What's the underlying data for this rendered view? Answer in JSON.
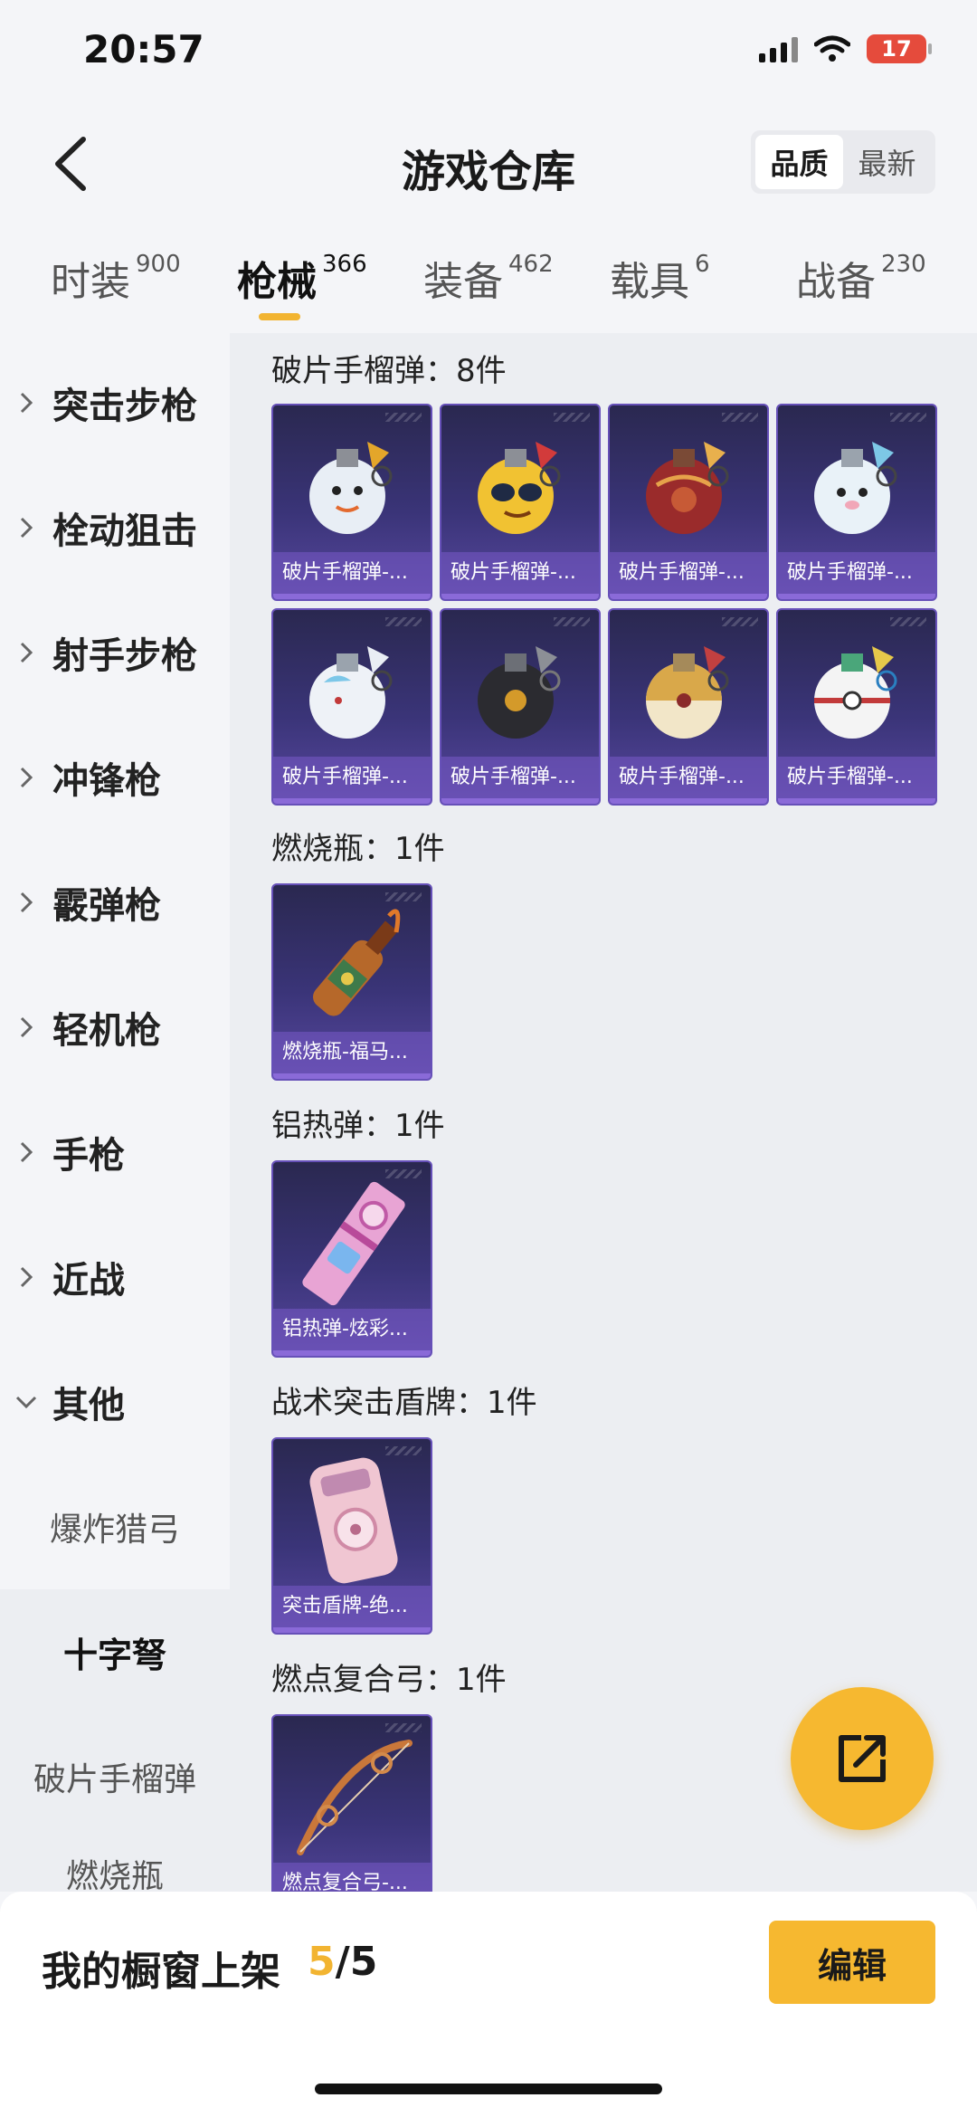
{
  "status_bar": {
    "time": "20:57",
    "battery": "17"
  },
  "header": {
    "title": "游戏仓库",
    "sort_options": [
      "品质",
      "最新"
    ],
    "active_sort": "品质"
  },
  "tabs": [
    {
      "label": "时装",
      "count": "900"
    },
    {
      "label": "枪械",
      "count": "366",
      "active": true
    },
    {
      "label": "装备",
      "count": "462"
    },
    {
      "label": "载具",
      "count": "6"
    },
    {
      "label": "战备",
      "count": "230"
    }
  ],
  "sidebar": {
    "categories": [
      "突击步枪",
      "栓动狙击",
      "射手步枪",
      "冲锋枪",
      "霰弹枪",
      "轻机枪",
      "手枪",
      "近战",
      "其他"
    ],
    "sub_items": [
      "爆炸猎弓",
      "十字弩",
      "破片手榴弹",
      "燃烧瓶"
    ],
    "selected_sub": "十字弩"
  },
  "sections": [
    {
      "title": "破片手榴弹：8件",
      "items": [
        "破片手榴弹-...",
        "破片手榴弹-...",
        "破片手榴弹-...",
        "破片手榴弹-...",
        "破片手榴弹-...",
        "破片手榴弹-...",
        "破片手榴弹-...",
        "破片手榴弹-..."
      ]
    },
    {
      "title": "燃烧瓶：1件",
      "items": [
        "燃烧瓶-福马..."
      ]
    },
    {
      "title": "铝热弹：1件",
      "items": [
        "铝热弹-炫彩..."
      ]
    },
    {
      "title": "战术突击盾牌：1件",
      "items": [
        "突击盾牌-绝..."
      ]
    },
    {
      "title": "燃点复合弓：1件",
      "items": [
        "燃点复合弓-..."
      ]
    }
  ],
  "bottom": {
    "showcase_label": "我的橱窗上架",
    "showcase_current": "5",
    "showcase_total": "/5",
    "edit_label": "编辑"
  },
  "colors": {
    "accent": "#f6b830",
    "card_top": "#2a2850",
    "card_bottom": "#57479e"
  }
}
